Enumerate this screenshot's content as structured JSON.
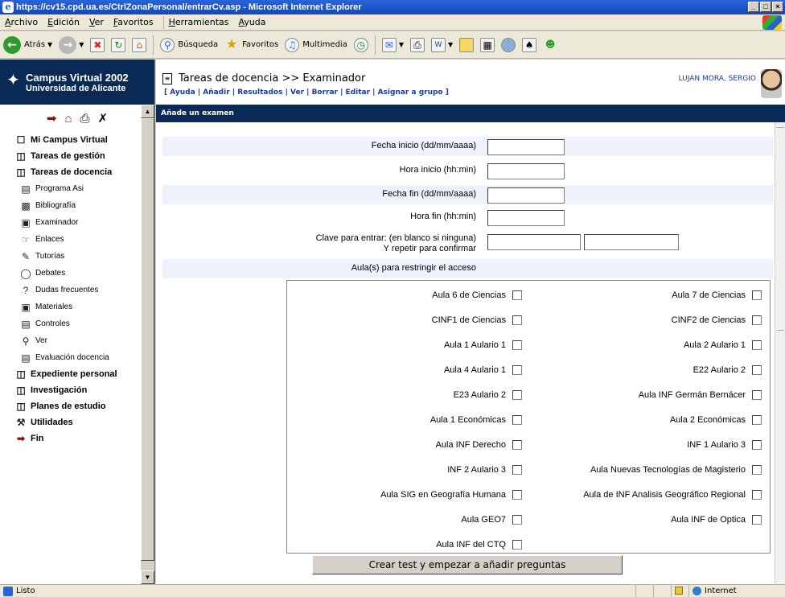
{
  "window": {
    "title": "https://cv15.cpd.ua.es/CtrlZonaPersonal/entrarCv.asp - Microsoft Internet Explorer",
    "buttons": [
      "_",
      "□",
      "×"
    ]
  },
  "menubar": {
    "items": [
      "Archivo",
      "Edición",
      "Ver",
      "Favoritos",
      "Herramientas",
      "Ayuda"
    ]
  },
  "toolbar": {
    "back_label": "Atrás",
    "search_label": "Búsqueda",
    "favorites_label": "Favoritos",
    "multimedia_label": "Multimedia"
  },
  "brand": {
    "title": "Campus Virtual 2002",
    "subtitle": "Universidad de Alicante"
  },
  "nav": {
    "items": [
      {
        "label": "Mi Campus Virtual",
        "level": 1,
        "icon": "campus-icon"
      },
      {
        "label": "Tareas de gestión",
        "level": 1,
        "icon": "folder-icon"
      },
      {
        "label": "Tareas de docencia",
        "level": 1,
        "icon": "folder-open-icon"
      },
      {
        "label": "Programa Asi",
        "level": 2,
        "icon": "document-icon"
      },
      {
        "label": "Bibliografía",
        "level": 2,
        "icon": "book-icon"
      },
      {
        "label": "Examinador",
        "level": 2,
        "icon": "exam-icon"
      },
      {
        "label": "Enlaces",
        "level": 2,
        "icon": "link-icon"
      },
      {
        "label": "Tutorías",
        "level": 2,
        "icon": "pencil-icon"
      },
      {
        "label": "Debates",
        "level": 2,
        "icon": "chat-icon"
      },
      {
        "label": "Dudas frecuentes",
        "level": 2,
        "icon": "question-icon"
      },
      {
        "label": "Materiales",
        "level": 2,
        "icon": "disk-icon"
      },
      {
        "label": "Controles",
        "level": 2,
        "icon": "checklist-icon"
      },
      {
        "label": "Ver",
        "level": 2,
        "icon": "view-icon"
      },
      {
        "label": "Evaluación docencia",
        "level": 2,
        "icon": "evaluation-icon"
      },
      {
        "label": "Expediente personal",
        "level": 1,
        "icon": "folder-icon"
      },
      {
        "label": "Investigación",
        "level": 1,
        "icon": "folder-bulb-icon"
      },
      {
        "label": "Planes de estudio",
        "level": 1,
        "icon": "folder-icon"
      },
      {
        "label": "Utilidades",
        "level": 1,
        "icon": "tools-icon"
      },
      {
        "label": "Fin",
        "level": 1,
        "icon": "exit-icon"
      }
    ]
  },
  "header": {
    "title": "Tareas de docencia >> Examinador",
    "actions": "[ Ayuda | Añadir | Resultados | Ver | Borrar | Editar | Asignar a grupo ]",
    "user": "LUJAN MORA, SERGIO"
  },
  "section": {
    "title": "Añade un examen"
  },
  "form": {
    "fecha_inicio_label": "Fecha inicio  (dd/mm/aaaa)",
    "hora_inicio_label": "Hora inicio  (hh:min)",
    "fecha_fin_label": "Fecha fin  (dd/mm/aaaa)",
    "hora_fin_label": "Hora fin  (hh:min)",
    "clave_label": "Clave para entrar: (en blanco si ninguna)",
    "repetir_label": "Y repetir para confirmar",
    "aulas_label": "Aula(s) para restringir el acceso",
    "submit_label": "Crear test y empezar a añadir preguntas"
  },
  "aulas": [
    "Aula 6 de Ciencias",
    "Aula 7 de Ciencias",
    "CINF1 de Ciencias",
    "CINF2 de Ciencias",
    "Aula 1 Aulario 1",
    "Aula 2 Aulario 1",
    "Aula 4 Aulario 1",
    "E22 Aulario 2",
    "E23 Aulario 2",
    "Aula INF Germán Bernácer",
    "Aula 1 Económicas",
    "Aula 2 Económicas",
    "Aula INF Derecho",
    "INF 1 Aulario 3",
    "INF 2 Aulario 3",
    "Aula Nuevas Tecnologías de Magisterio",
    "Aula SIG en Geografía Humana",
    "Aula de INF Analisis Geográfico Regional",
    "Aula GEO7",
    "Aula INF de Optica",
    "Aula INF del CTQ"
  ],
  "status": {
    "text": "Listo",
    "zone": "Internet"
  }
}
